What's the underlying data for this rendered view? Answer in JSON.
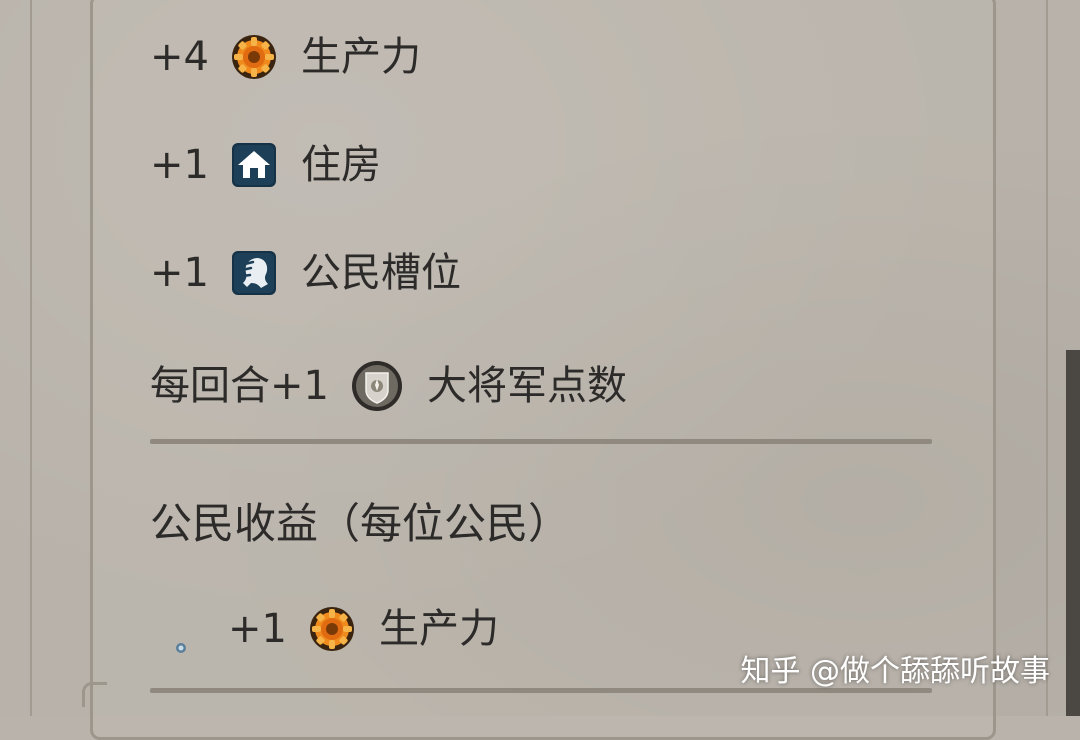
{
  "yields": [
    {
      "amount": "+4",
      "icon": "production-gear-icon",
      "label": "生产力"
    },
    {
      "amount": "+1",
      "icon": "housing-house-icon",
      "label": "住房"
    },
    {
      "amount": "+1",
      "icon": "citizen-slot-icon",
      "label": "公民槽位"
    },
    {
      "amount": "每回合+1",
      "icon": "great-general-point-icon",
      "label": "大将军点数"
    }
  ],
  "citizen_section": {
    "title": "公民收益（每位公民）",
    "bullet_icon": "bullet-icon",
    "items": [
      {
        "amount": "+1",
        "icon": "production-gear-icon",
        "label": "生产力"
      }
    ]
  },
  "watermark": "知乎 @做个舔舔听故事",
  "colors": {
    "paper": "#b8b2aa",
    "text": "#2c2b29",
    "panel_border": "#9d968d",
    "divider": "#8f8980",
    "production_orange": "#e07a17",
    "icon_navy": "#163247"
  }
}
